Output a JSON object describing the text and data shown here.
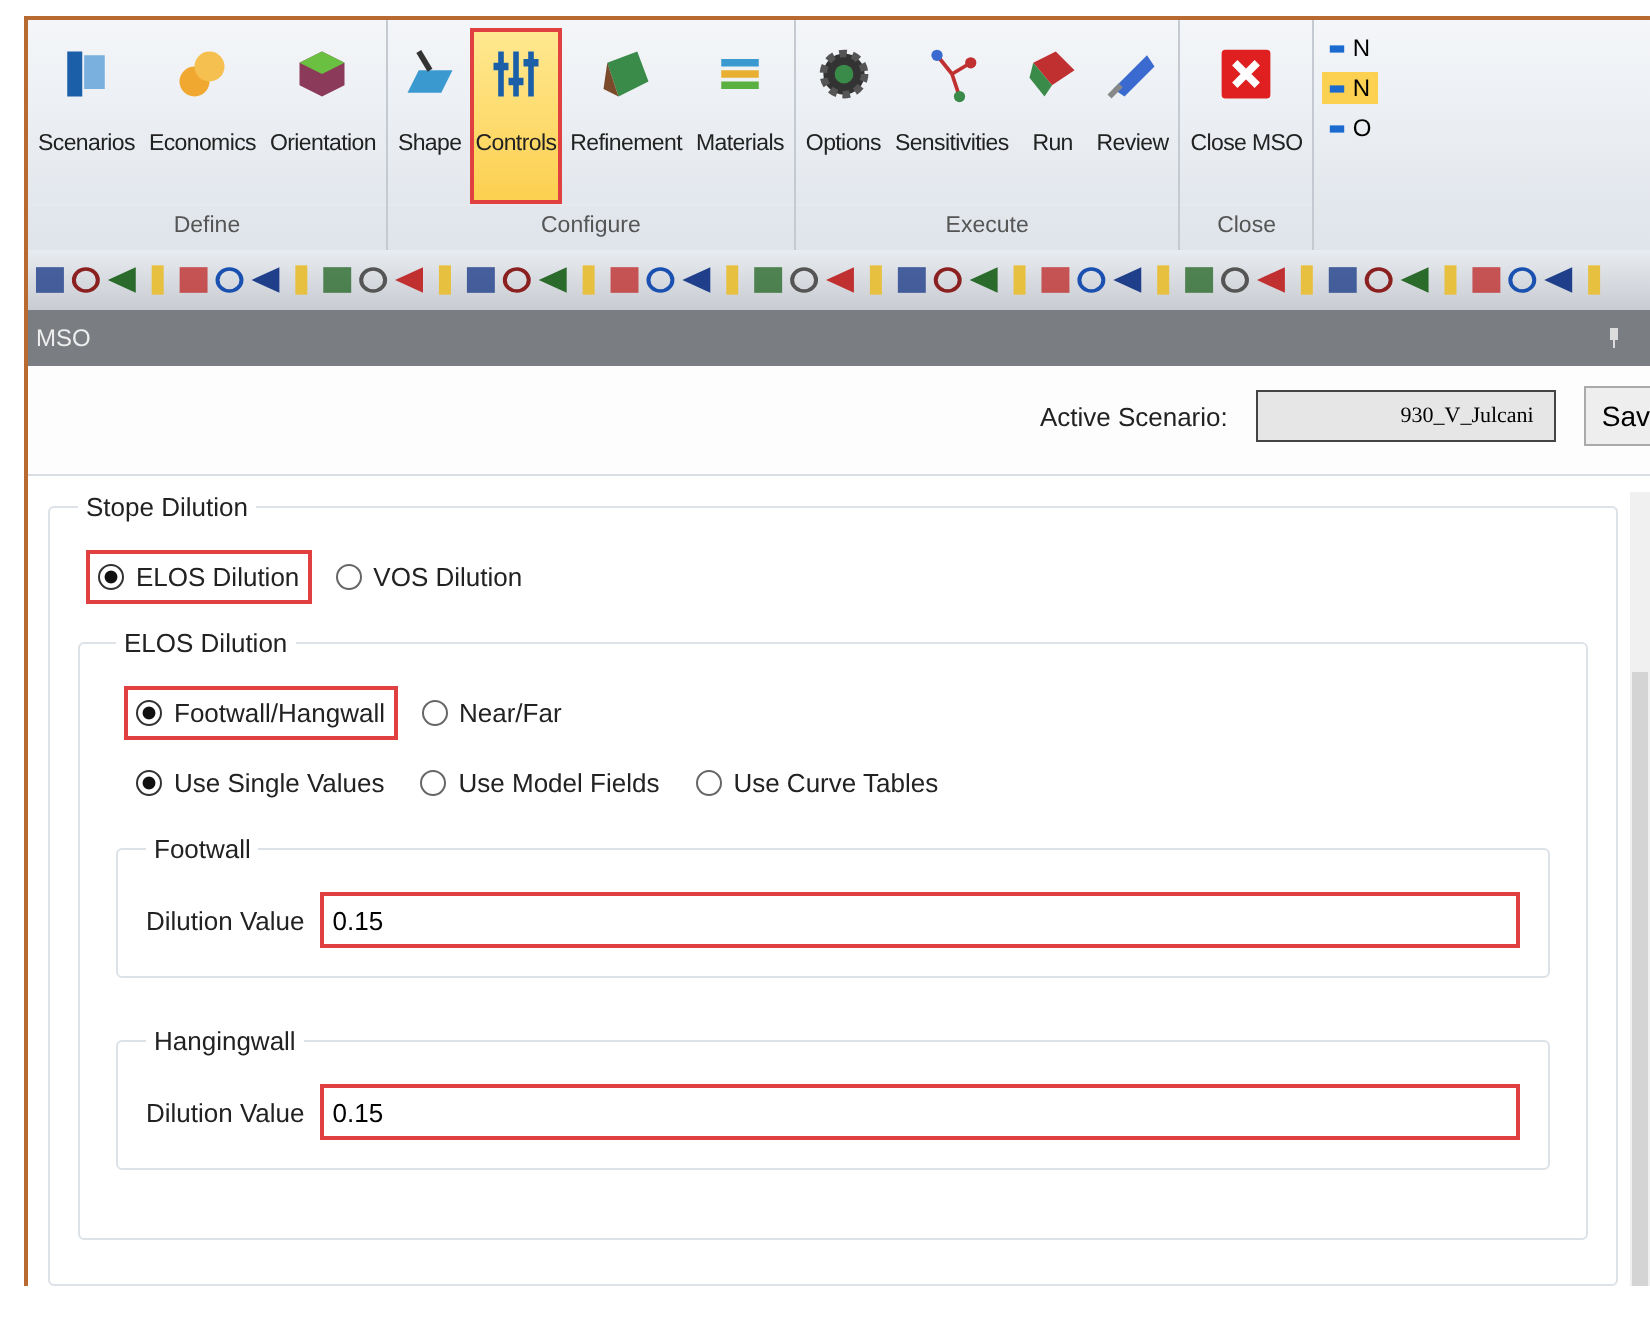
{
  "ribbon": {
    "groups": [
      {
        "label": "Define",
        "buttons": [
          {
            "label": "Scenarios",
            "selected": false
          },
          {
            "label": "Economics",
            "selected": false
          },
          {
            "label": "Orientation",
            "selected": false
          }
        ]
      },
      {
        "label": "Configure",
        "buttons": [
          {
            "label": "Shape",
            "selected": false
          },
          {
            "label": "Controls",
            "selected": true,
            "highlighted": true
          },
          {
            "label": "Refinement",
            "selected": false
          },
          {
            "label": "Materials",
            "selected": false
          }
        ]
      },
      {
        "label": "Execute",
        "buttons": [
          {
            "label": "Options",
            "selected": false
          },
          {
            "label": "Sensitivities",
            "selected": false
          },
          {
            "label": "Run",
            "selected": false
          },
          {
            "label": "Review",
            "selected": false
          }
        ]
      },
      {
        "label": "Close",
        "buttons": [
          {
            "label": "Close MSO",
            "selected": false
          }
        ]
      }
    ],
    "side_items": [
      {
        "label": "N",
        "selected": false
      },
      {
        "label": "N",
        "selected": true
      },
      {
        "label": "O",
        "selected": false
      }
    ]
  },
  "panel": {
    "title": "MSO"
  },
  "active_scenario": {
    "label": "Active Scenario:",
    "value": "930_V_Julcani"
  },
  "save_button": "Sav",
  "stope_dilution": {
    "title": "Stope Dilution",
    "method_options": [
      {
        "label": "ELOS Dilution",
        "selected": true,
        "highlighted": true
      },
      {
        "label": "VOS Dilution",
        "selected": false
      }
    ],
    "elos": {
      "title": "ELOS Dilution",
      "side_options": [
        {
          "label": "Footwall/Hangwall",
          "selected": true,
          "highlighted": true
        },
        {
          "label": "Near/Far",
          "selected": false
        }
      ],
      "value_options": [
        {
          "label": "Use Single Values",
          "selected": true
        },
        {
          "label": "Use Model Fields",
          "selected": false
        },
        {
          "label": "Use Curve Tables",
          "selected": false
        }
      ],
      "sections": [
        {
          "title": "Footwall",
          "field_label": "Dilution Value",
          "value": "0.15",
          "highlighted": true
        },
        {
          "title": "Hangingwall",
          "field_label": "Dilution Value",
          "value": "0.15",
          "highlighted": true
        }
      ]
    }
  }
}
